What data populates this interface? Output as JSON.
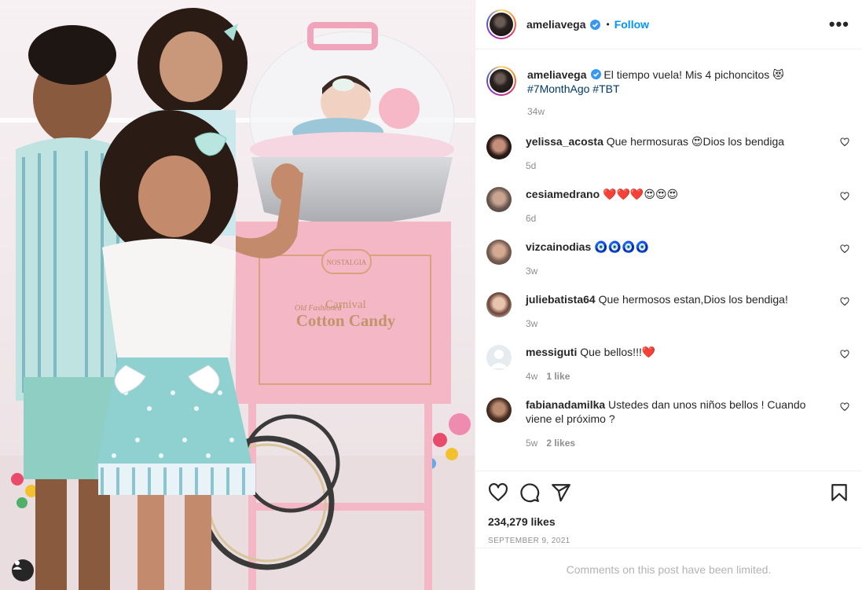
{
  "post": {
    "author": "ameliavega",
    "follow_label": "Follow",
    "more_label": "•••",
    "dot": "•",
    "verified": true
  },
  "caption": {
    "user": "ameliavega",
    "text": "El tiempo vuela! Mis 4 pichoncitos 😻",
    "hashtags": "#7MonthAgo #TBT",
    "time": "34w"
  },
  "comments": [
    {
      "user": "yelissa_acosta",
      "text": "Que hermosuras 😍Dios los bendiga",
      "time": "5d",
      "likes": ""
    },
    {
      "user": "cesiamedrano",
      "text": "❤️❤️❤️😍😍😍",
      "time": "6d",
      "likes": ""
    },
    {
      "user": "vizcainodias",
      "text": "🧿🧿🧿🧿",
      "time": "3w",
      "likes": ""
    },
    {
      "user": "juliebatista64",
      "text": "Que hermosos estan,Dios los bendiga!",
      "time": "3w",
      "likes": ""
    },
    {
      "user": "messiguti",
      "text": "Que bellos!!!❤️",
      "time": "4w",
      "likes": "1 like"
    },
    {
      "user": "fabianadamilka",
      "text": "Ustedes dan unos niños bellos ! Cuando viene el próximo ?",
      "time": "5w",
      "likes": "2 likes"
    }
  ],
  "photo": {
    "sign_brand": "NOSTALGIA",
    "sign_small": "Old Fashioned",
    "sign_line1": "Carnival",
    "sign_line2": "Cotton Candy"
  },
  "engagement": {
    "likes": "234,279 likes",
    "date": "September 9, 2021"
  },
  "footer": {
    "limited": "Comments on this post have been limited."
  },
  "colors": {
    "accent": "#0095f6",
    "hashtag": "#00376b",
    "verified": "#3897f0",
    "muted": "#8e8e8e",
    "heart_red": "#ed4956",
    "cart_pink": "#f4b7c6"
  },
  "icons": {
    "like": "heart-icon",
    "comment": "comment-icon",
    "share": "paper-plane-icon",
    "save": "bookmark-icon",
    "tags": "user-tag-icon",
    "more": "more-icon",
    "verified": "verified-badge-icon"
  }
}
